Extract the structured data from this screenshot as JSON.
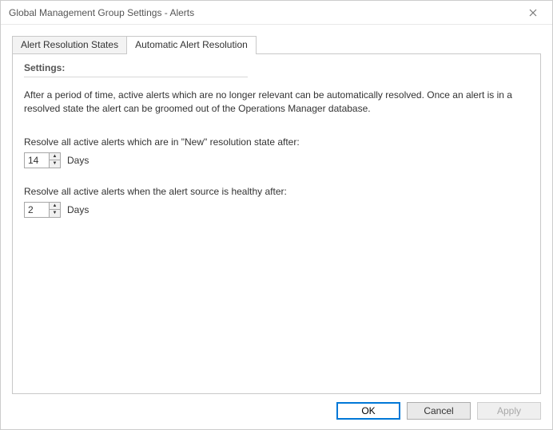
{
  "window": {
    "title": "Global Management Group Settings - Alerts"
  },
  "tabs": {
    "alert_resolution_states": "Alert Resolution States",
    "automatic_alert_resolution": "Automatic Alert Resolution"
  },
  "settings": {
    "heading": "Settings:",
    "description": "After a period of time, active alerts which are no longer relevant can be automatically resolved. Once an alert is in a resolved state the alert can be groomed out of the Operations Manager database.",
    "resolve_new_label": "Resolve all active alerts which are in \"New\" resolution state after:",
    "resolve_new_value": "14",
    "resolve_new_unit": "Days",
    "resolve_healthy_label": "Resolve all active alerts when the alert source is healthy after:",
    "resolve_healthy_value": "2",
    "resolve_healthy_unit": "Days"
  },
  "buttons": {
    "ok": "OK",
    "cancel": "Cancel",
    "apply": "Apply"
  }
}
